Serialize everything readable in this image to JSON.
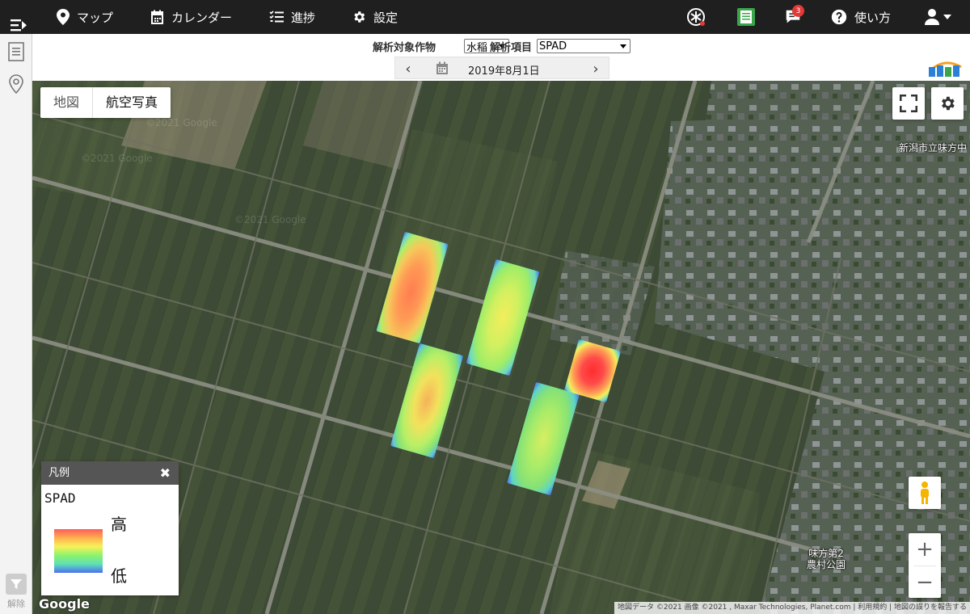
{
  "nav": {
    "map": "マップ",
    "calendar": "カレンダー",
    "progress": "進捗",
    "settings": "設定",
    "help": "使い方",
    "notification_count": "3"
  },
  "controls": {
    "crop_label": "解析対象作物",
    "crop_value": "水稲",
    "item_label": "解析項目",
    "item_value": "SPAD",
    "date": "2019年8月1日",
    "prev": "‹",
    "next": "›"
  },
  "rail": {
    "unlock_label": "解除"
  },
  "map": {
    "type_map": "地図",
    "type_satellite": "航空写真",
    "place_1": "新潟市立味方中",
    "place_2_line1": "味方第2",
    "place_2_line2": "農村公園",
    "attribution": "地図データ ©2021 画像 ©2021 , Maxar Technologies, Planet.com  |  利用規約  |  地図の誤りを報告する",
    "google": "Google",
    "zoom_in": "+",
    "zoom_out": "−"
  },
  "legend": {
    "header": "凡例",
    "close": "✖",
    "title": "SPAD",
    "high": "高",
    "low": "低"
  },
  "colors": {
    "topbar": "#1f1f1f",
    "heat_high": "#ff4a4a",
    "heat_low": "#3f64e8"
  }
}
